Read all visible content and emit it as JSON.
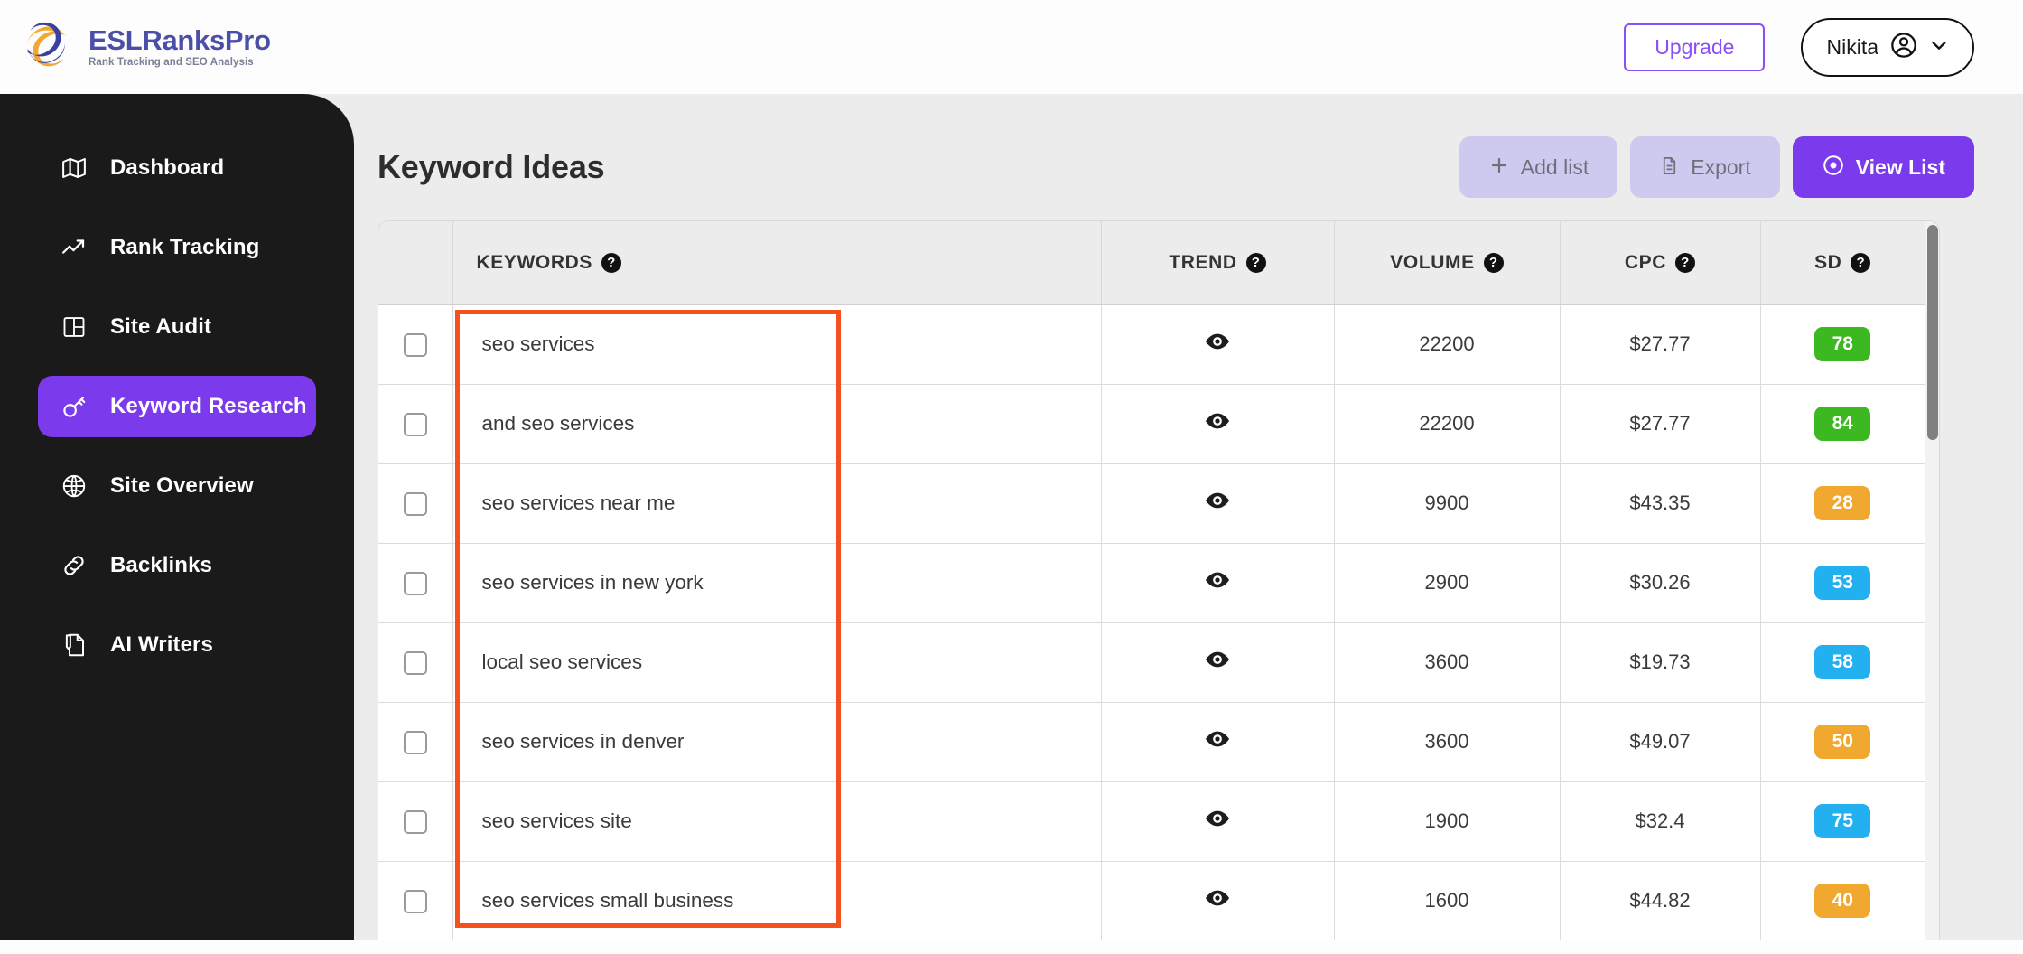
{
  "header": {
    "brand_name": "ESLRanksPro",
    "brand_tagline": "Rank Tracking and SEO Analysis",
    "upgrade_label": "Upgrade",
    "user_name": "Nikita",
    "user_icon": "user-circle-icon",
    "chevron_icon": "chevron-down-icon",
    "accent_purple": "#7c3aed",
    "brand_blue": "#4b4fa8",
    "brand_orange": "#f2a830"
  },
  "sidebar": {
    "items": [
      {
        "label": "Dashboard",
        "icon": "map-icon",
        "active": false
      },
      {
        "label": "Rank Tracking",
        "icon": "trending-up-icon",
        "active": false
      },
      {
        "label": "Site Audit",
        "icon": "layout-grid-icon",
        "active": false
      },
      {
        "label": "Keyword Research",
        "icon": "key-icon",
        "active": true
      },
      {
        "label": "Site Overview",
        "icon": "globe-icon",
        "active": false
      },
      {
        "label": "Backlinks",
        "icon": "link-icon",
        "active": false
      },
      {
        "label": "AI Writers",
        "icon": "document-pen-icon",
        "active": false
      }
    ]
  },
  "main": {
    "page_title": "Keyword Ideas",
    "buttons": [
      {
        "label": "Add list",
        "icon": "plus-icon",
        "state": "disabled"
      },
      {
        "label": "Export",
        "icon": "file-export-icon",
        "state": "disabled"
      },
      {
        "label": "View List",
        "icon": "eye-circle-icon",
        "state": "primary"
      }
    ]
  },
  "table": {
    "columns": [
      {
        "key": "checkbox",
        "label": ""
      },
      {
        "key": "keywords",
        "label": "KEYWORDS",
        "help": "?"
      },
      {
        "key": "trend",
        "label": "TREND",
        "help": "?"
      },
      {
        "key": "volume",
        "label": "VOLUME",
        "help": "?"
      },
      {
        "key": "cpc",
        "label": "CPC",
        "help": "?"
      },
      {
        "key": "sd",
        "label": "SD",
        "help": "?"
      }
    ],
    "rows": [
      {
        "keyword": "seo services",
        "trend_icon": "eye-icon",
        "volume": "22200",
        "cpc": "$27.77",
        "sd": "78",
        "sd_color": "#3cb820"
      },
      {
        "keyword": "and seo services",
        "trend_icon": "eye-icon",
        "volume": "22200",
        "cpc": "$27.77",
        "sd": "84",
        "sd_color": "#3cb820"
      },
      {
        "keyword": "seo services near me",
        "trend_icon": "eye-icon",
        "volume": "9900",
        "cpc": "$43.35",
        "sd": "28",
        "sd_color": "#f0a82e"
      },
      {
        "keyword": "seo services in new york",
        "trend_icon": "eye-icon",
        "volume": "2900",
        "cpc": "$30.26",
        "sd": "53",
        "sd_color": "#23b0f0"
      },
      {
        "keyword": "local seo services",
        "trend_icon": "eye-icon",
        "volume": "3600",
        "cpc": "$19.73",
        "sd": "58",
        "sd_color": "#23b0f0"
      },
      {
        "keyword": "seo services in denver",
        "trend_icon": "eye-icon",
        "volume": "3600",
        "cpc": "$49.07",
        "sd": "50",
        "sd_color": "#f0a82e"
      },
      {
        "keyword": "seo services site",
        "trend_icon": "eye-icon",
        "volume": "1900",
        "cpc": "$32.4",
        "sd": "75",
        "sd_color": "#23b0f0"
      },
      {
        "keyword": "seo services small business",
        "trend_icon": "eye-icon",
        "volume": "1600",
        "cpc": "$44.82",
        "sd": "40",
        "sd_color": "#f0a82e"
      }
    ]
  },
  "annotation": {
    "color": "#f4511e",
    "target": "keywords-column"
  }
}
